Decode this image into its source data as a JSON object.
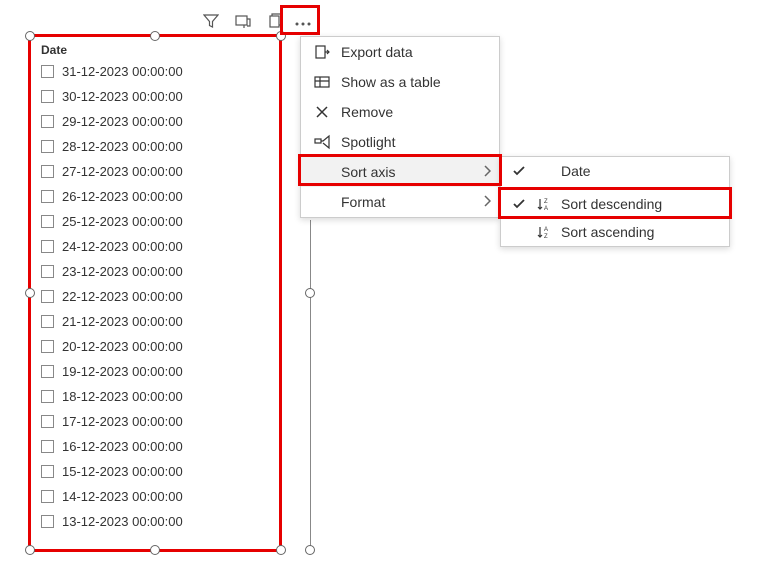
{
  "visual": {
    "header": "Date",
    "items": [
      "31-12-2023 00:00:00",
      "30-12-2023 00:00:00",
      "29-12-2023 00:00:00",
      "28-12-2023 00:00:00",
      "27-12-2023 00:00:00",
      "26-12-2023 00:00:00",
      "25-12-2023 00:00:00",
      "24-12-2023 00:00:00",
      "23-12-2023 00:00:00",
      "22-12-2023 00:00:00",
      "21-12-2023 00:00:00",
      "20-12-2023 00:00:00",
      "19-12-2023 00:00:00",
      "18-12-2023 00:00:00",
      "17-12-2023 00:00:00",
      "16-12-2023 00:00:00",
      "15-12-2023 00:00:00",
      "14-12-2023 00:00:00",
      "13-12-2023 00:00:00"
    ]
  },
  "menu": {
    "export": "Export data",
    "show_table": "Show as a table",
    "remove": "Remove",
    "spotlight": "Spotlight",
    "sort_axis": "Sort axis",
    "format": "Format"
  },
  "submenu": {
    "date": "Date",
    "sort_desc": "Sort descending",
    "sort_asc": "Sort ascending"
  }
}
